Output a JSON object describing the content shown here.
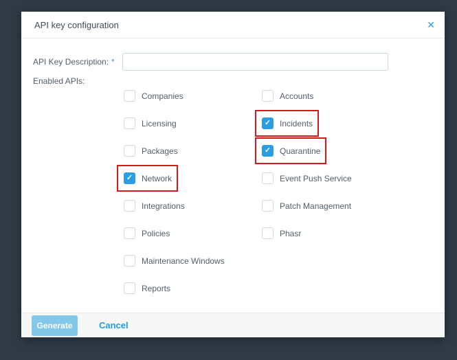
{
  "dialog": {
    "title": "API key configuration"
  },
  "icons": {
    "close": "✕",
    "checkmark": "✓"
  },
  "form": {
    "description_label": "API Key Description:",
    "required_marker": "*",
    "description_value": "",
    "enabled_apis_label": "Enabled APIs:"
  },
  "apis": {
    "columns": [
      {
        "items": [
          {
            "label": "Companies",
            "checked": false,
            "highlighted": false
          },
          {
            "label": "Licensing",
            "checked": false,
            "highlighted": false
          },
          {
            "label": "Packages",
            "checked": false,
            "highlighted": false
          },
          {
            "label": "Network",
            "checked": true,
            "highlighted": true
          },
          {
            "label": "Integrations",
            "checked": false,
            "highlighted": false
          },
          {
            "label": "Policies",
            "checked": false,
            "highlighted": false
          },
          {
            "label": "Maintenance Windows",
            "checked": false,
            "highlighted": false
          },
          {
            "label": "Reports",
            "checked": false,
            "highlighted": false
          }
        ]
      },
      {
        "items": [
          {
            "label": "Accounts",
            "checked": false,
            "highlighted": false
          },
          {
            "label": "Incidents",
            "checked": true,
            "highlighted": true
          },
          {
            "label": "Quarantine",
            "checked": true,
            "highlighted": true
          },
          {
            "label": "Event Push Service",
            "checked": false,
            "highlighted": false
          },
          {
            "label": "Patch Management",
            "checked": false,
            "highlighted": false
          },
          {
            "label": "Phasr",
            "checked": false,
            "highlighted": false
          }
        ]
      }
    ]
  },
  "footer": {
    "generate_label": "Generate",
    "cancel_label": "Cancel"
  },
  "colors": {
    "overlay_bg": "#2f3a45",
    "accent_blue": "#2d9de2",
    "annotation_red": "#d11a1a",
    "generate_bg": "#82c8e9",
    "cancel_text": "#1e9cd7"
  }
}
